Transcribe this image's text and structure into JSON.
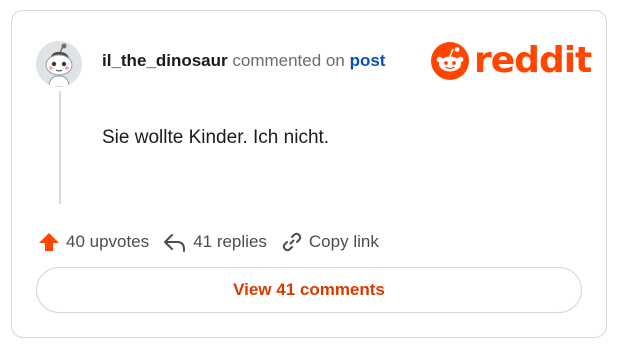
{
  "comment": {
    "username": "il_the_dinosaur",
    "commented_on_text": "commented on",
    "post_link_label": "post",
    "body": "Sie wollte Kinder. Ich nicht."
  },
  "brand": {
    "logo_text": "reddit",
    "color": "#ff4500"
  },
  "actions": {
    "upvotes_label": "40 upvotes",
    "replies_label": "41 replies",
    "copy_link_label": "Copy link"
  },
  "view_comments_label": "View 41 comments",
  "icons": [
    "upvote-arrow-icon",
    "reply-icon",
    "link-icon",
    "reddit-snoo-icon"
  ]
}
